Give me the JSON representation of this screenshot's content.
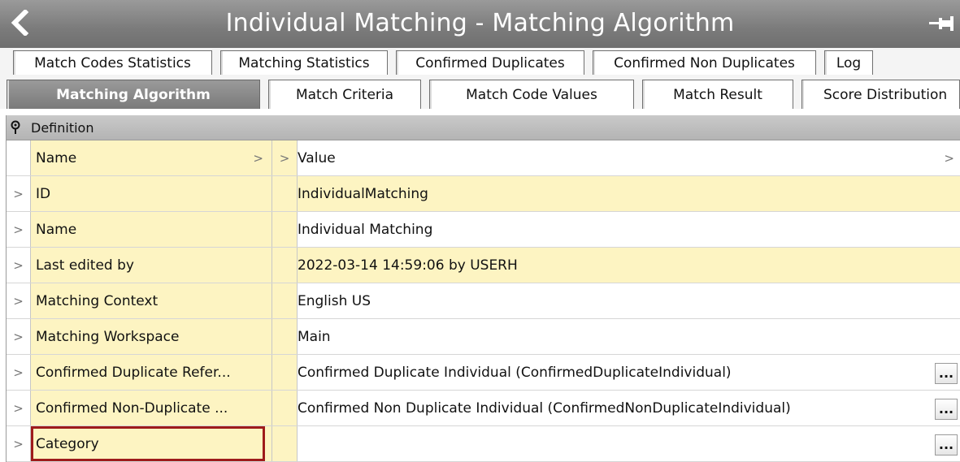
{
  "window": {
    "title": "Individual Matching - Matching Algorithm",
    "back_icon": "chevron-left-icon",
    "pin_icon": "pin-icon"
  },
  "tabs_row1": [
    {
      "label": "Match Codes Statistics"
    },
    {
      "label": "Matching Statistics"
    },
    {
      "label": "Confirmed Duplicates"
    },
    {
      "label": "Confirmed Non Duplicates"
    },
    {
      "label": "Log"
    }
  ],
  "tabs_row2": [
    {
      "label": "Matching Algorithm",
      "active": true
    },
    {
      "label": "Match Criteria"
    },
    {
      "label": "Match Code Values"
    },
    {
      "label": "Match Result"
    },
    {
      "label": "Score Distribution"
    }
  ],
  "section": {
    "label": "Definition"
  },
  "grid": {
    "header": {
      "name": "Name",
      "value": "Value"
    },
    "rows": [
      {
        "name": "ID",
        "value": "IndividualMatching"
      },
      {
        "name": "Name",
        "value": "Individual Matching"
      },
      {
        "name": "Last edited by",
        "value": "2022-03-14 14:59:06 by USERH"
      },
      {
        "name": "Matching Context",
        "value": "English US"
      },
      {
        "name": "Matching Workspace",
        "value": "Main"
      },
      {
        "name": "Confirmed Duplicate Refer...",
        "value": "Confirmed Duplicate Individual (ConfirmedDuplicateIndividual)",
        "ellipsis": "..."
      },
      {
        "name": "Confirmed Non-Duplicate ...",
        "value": "Confirmed Non Duplicate Individual (ConfirmedNonDuplicateIndividual)",
        "ellipsis": "..."
      },
      {
        "name": "Category",
        "value": "",
        "ellipsis": "..."
      }
    ]
  },
  "glyphs": {
    "expand": ">"
  },
  "colors": {
    "title_bar": "#7b7b7b",
    "cell_yellow": "#fdf4c2",
    "selection": "#9e1b1b"
  }
}
